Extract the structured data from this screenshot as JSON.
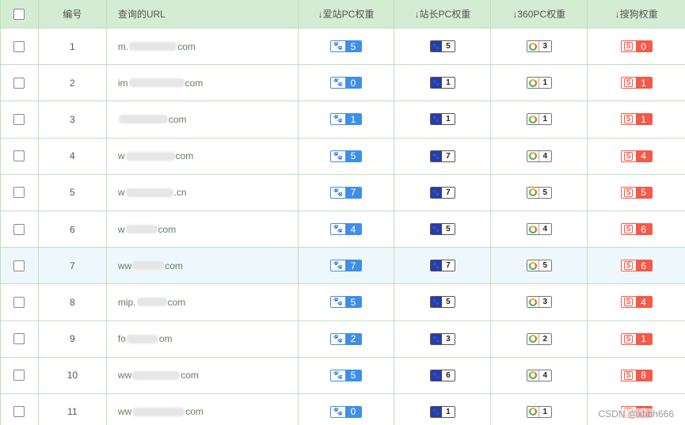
{
  "header": {
    "num": "编号",
    "url": "查询的URL",
    "aizhan": "↓爱站PC权重",
    "zhanzhang": "↓站长PC权重",
    "pc360": "↓360PC权重",
    "sogou": "↓搜狗权重"
  },
  "icons": {
    "aizhan": "baidu-paw-icon",
    "zhanzhang": "baidu-paw-icon",
    "pc360": "360-ring-icon",
    "sogou": "sogou-s-icon"
  },
  "colors": {
    "header_bg": "#d4ecd4",
    "aizhan": "#3f8ee8",
    "zhanzhang": "#2d3aa8",
    "sogou": "#f25a4a",
    "highlight_row": "#eef7fc"
  },
  "rows": [
    {
      "num": "1",
      "url_start": "m.",
      "url_end": "com",
      "aizhan": "5",
      "zz": "5",
      "p360": "3",
      "sogou": "0"
    },
    {
      "num": "2",
      "url_start": "im",
      "url_end": "com",
      "aizhan": "0",
      "zz": "1",
      "p360": "1",
      "sogou": "1"
    },
    {
      "num": "3",
      "url_start": "",
      "url_end": "com",
      "aizhan": "1",
      "zz": "1",
      "p360": "1",
      "sogou": "1"
    },
    {
      "num": "4",
      "url_start": "w",
      "url_end": "com",
      "aizhan": "5",
      "zz": "7",
      "p360": "4",
      "sogou": "4"
    },
    {
      "num": "5",
      "url_start": "w",
      "url_end": ".cn",
      "aizhan": "7",
      "zz": "7",
      "p360": "5",
      "sogou": "5"
    },
    {
      "num": "6",
      "url_start": "w",
      "url_end": "com",
      "aizhan": "4",
      "zz": "5",
      "p360": "4",
      "sogou": "6"
    },
    {
      "num": "7",
      "url_start": "ww",
      "url_end": "com",
      "aizhan": "7",
      "zz": "7",
      "p360": "5",
      "sogou": "6"
    },
    {
      "num": "8",
      "url_start": "mip.",
      "url_end": "com",
      "aizhan": "5",
      "zz": "5",
      "p360": "3",
      "sogou": "4"
    },
    {
      "num": "9",
      "url_start": "fo",
      "url_end": "om",
      "aizhan": "2",
      "zz": "3",
      "p360": "2",
      "sogou": "1"
    },
    {
      "num": "10",
      "url_start": "ww",
      "url_end": "com",
      "aizhan": "5",
      "zz": "6",
      "p360": "4",
      "sogou": "8"
    },
    {
      "num": "11",
      "url_start": "ww",
      "url_end": "com",
      "aizhan": "0",
      "zz": "1",
      "p360": "1",
      "sogou": "0"
    }
  ],
  "watermark": "CSDN @xhbh666"
}
